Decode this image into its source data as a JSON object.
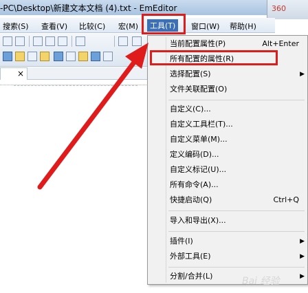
{
  "window": {
    "title": "-PC\\Desktop\\新建文本文档 (4).txt - EmEditor",
    "corner_label": "360"
  },
  "menubar": {
    "items": [
      "搜索(S)",
      "查看(V)",
      "比较(C)",
      "宏(M)",
      "工具(T)",
      "窗口(W)",
      "帮助(H)"
    ],
    "active_index": 4
  },
  "tab": {
    "close": "×"
  },
  "tools_menu": {
    "items": [
      {
        "label": "当前配置属性(P)",
        "shortcut": "Alt+Enter"
      },
      {
        "label": "所有配置的属性(R)",
        "shortcut": ""
      },
      {
        "label": "选择配置(S)",
        "shortcut": "",
        "submenu": true
      },
      {
        "label": "文件关联配置(O)",
        "shortcut": ""
      },
      {
        "label": "自定义(C)...",
        "shortcut": ""
      },
      {
        "label": "自定义工具栏(T)...",
        "shortcut": ""
      },
      {
        "label": "自定义菜单(M)...",
        "shortcut": ""
      },
      {
        "label": "定义编码(D)...",
        "shortcut": ""
      },
      {
        "label": "自定义标记(U)...",
        "shortcut": ""
      },
      {
        "label": "所有命令(A)...",
        "shortcut": ""
      },
      {
        "label": "快捷启动(Q)",
        "shortcut": "Ctrl+Q"
      },
      {
        "label": "导入和导出(X)...",
        "shortcut": ""
      },
      {
        "label": "插件(I)",
        "shortcut": "",
        "submenu": true
      },
      {
        "label": "外部工具(E)",
        "shortcut": "",
        "submenu": true
      },
      {
        "label": "分割/合并(L)",
        "shortcut": "",
        "submenu": true
      }
    ]
  },
  "annotation": {
    "highlight_color": "#e01b1b"
  },
  "colors": {
    "menu_active": "#3b6fb6"
  }
}
